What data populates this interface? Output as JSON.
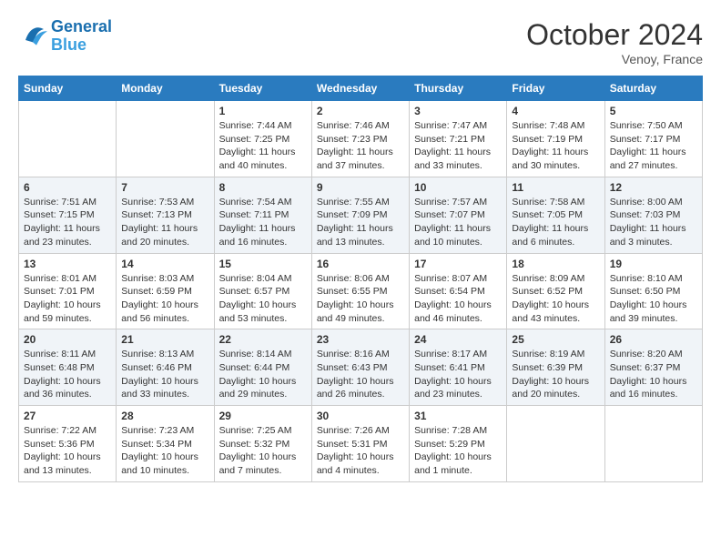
{
  "header": {
    "logo_line1": "General",
    "logo_line2": "Blue",
    "month_title": "October 2024",
    "location": "Venoy, France"
  },
  "weekdays": [
    "Sunday",
    "Monday",
    "Tuesday",
    "Wednesday",
    "Thursday",
    "Friday",
    "Saturday"
  ],
  "weeks": [
    [
      {
        "day": "",
        "info": ""
      },
      {
        "day": "",
        "info": ""
      },
      {
        "day": "1",
        "info": "Sunrise: 7:44 AM\nSunset: 7:25 PM\nDaylight: 11 hours and 40 minutes."
      },
      {
        "day": "2",
        "info": "Sunrise: 7:46 AM\nSunset: 7:23 PM\nDaylight: 11 hours and 37 minutes."
      },
      {
        "day": "3",
        "info": "Sunrise: 7:47 AM\nSunset: 7:21 PM\nDaylight: 11 hours and 33 minutes."
      },
      {
        "day": "4",
        "info": "Sunrise: 7:48 AM\nSunset: 7:19 PM\nDaylight: 11 hours and 30 minutes."
      },
      {
        "day": "5",
        "info": "Sunrise: 7:50 AM\nSunset: 7:17 PM\nDaylight: 11 hours and 27 minutes."
      }
    ],
    [
      {
        "day": "6",
        "info": "Sunrise: 7:51 AM\nSunset: 7:15 PM\nDaylight: 11 hours and 23 minutes."
      },
      {
        "day": "7",
        "info": "Sunrise: 7:53 AM\nSunset: 7:13 PM\nDaylight: 11 hours and 20 minutes."
      },
      {
        "day": "8",
        "info": "Sunrise: 7:54 AM\nSunset: 7:11 PM\nDaylight: 11 hours and 16 minutes."
      },
      {
        "day": "9",
        "info": "Sunrise: 7:55 AM\nSunset: 7:09 PM\nDaylight: 11 hours and 13 minutes."
      },
      {
        "day": "10",
        "info": "Sunrise: 7:57 AM\nSunset: 7:07 PM\nDaylight: 11 hours and 10 minutes."
      },
      {
        "day": "11",
        "info": "Sunrise: 7:58 AM\nSunset: 7:05 PM\nDaylight: 11 hours and 6 minutes."
      },
      {
        "day": "12",
        "info": "Sunrise: 8:00 AM\nSunset: 7:03 PM\nDaylight: 11 hours and 3 minutes."
      }
    ],
    [
      {
        "day": "13",
        "info": "Sunrise: 8:01 AM\nSunset: 7:01 PM\nDaylight: 10 hours and 59 minutes."
      },
      {
        "day": "14",
        "info": "Sunrise: 8:03 AM\nSunset: 6:59 PM\nDaylight: 10 hours and 56 minutes."
      },
      {
        "day": "15",
        "info": "Sunrise: 8:04 AM\nSunset: 6:57 PM\nDaylight: 10 hours and 53 minutes."
      },
      {
        "day": "16",
        "info": "Sunrise: 8:06 AM\nSunset: 6:55 PM\nDaylight: 10 hours and 49 minutes."
      },
      {
        "day": "17",
        "info": "Sunrise: 8:07 AM\nSunset: 6:54 PM\nDaylight: 10 hours and 46 minutes."
      },
      {
        "day": "18",
        "info": "Sunrise: 8:09 AM\nSunset: 6:52 PM\nDaylight: 10 hours and 43 minutes."
      },
      {
        "day": "19",
        "info": "Sunrise: 8:10 AM\nSunset: 6:50 PM\nDaylight: 10 hours and 39 minutes."
      }
    ],
    [
      {
        "day": "20",
        "info": "Sunrise: 8:11 AM\nSunset: 6:48 PM\nDaylight: 10 hours and 36 minutes."
      },
      {
        "day": "21",
        "info": "Sunrise: 8:13 AM\nSunset: 6:46 PM\nDaylight: 10 hours and 33 minutes."
      },
      {
        "day": "22",
        "info": "Sunrise: 8:14 AM\nSunset: 6:44 PM\nDaylight: 10 hours and 29 minutes."
      },
      {
        "day": "23",
        "info": "Sunrise: 8:16 AM\nSunset: 6:43 PM\nDaylight: 10 hours and 26 minutes."
      },
      {
        "day": "24",
        "info": "Sunrise: 8:17 AM\nSunset: 6:41 PM\nDaylight: 10 hours and 23 minutes."
      },
      {
        "day": "25",
        "info": "Sunrise: 8:19 AM\nSunset: 6:39 PM\nDaylight: 10 hours and 20 minutes."
      },
      {
        "day": "26",
        "info": "Sunrise: 8:20 AM\nSunset: 6:37 PM\nDaylight: 10 hours and 16 minutes."
      }
    ],
    [
      {
        "day": "27",
        "info": "Sunrise: 7:22 AM\nSunset: 5:36 PM\nDaylight: 10 hours and 13 minutes."
      },
      {
        "day": "28",
        "info": "Sunrise: 7:23 AM\nSunset: 5:34 PM\nDaylight: 10 hours and 10 minutes."
      },
      {
        "day": "29",
        "info": "Sunrise: 7:25 AM\nSunset: 5:32 PM\nDaylight: 10 hours and 7 minutes."
      },
      {
        "day": "30",
        "info": "Sunrise: 7:26 AM\nSunset: 5:31 PM\nDaylight: 10 hours and 4 minutes."
      },
      {
        "day": "31",
        "info": "Sunrise: 7:28 AM\nSunset: 5:29 PM\nDaylight: 10 hours and 1 minute."
      },
      {
        "day": "",
        "info": ""
      },
      {
        "day": "",
        "info": ""
      }
    ]
  ]
}
